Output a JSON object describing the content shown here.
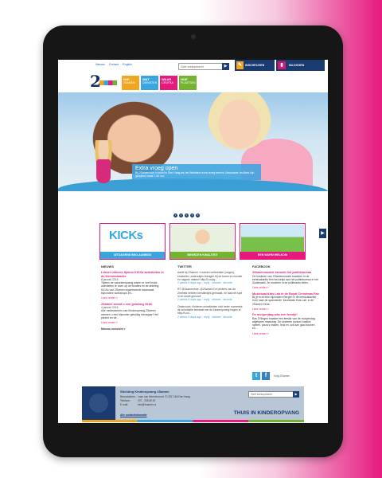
{
  "header": {
    "top_links": [
      "Nieuws",
      "Contact",
      "English"
    ],
    "search_placeholder": "Geef zoekopdracht",
    "inschrijven": "INSCHRIJVEN",
    "inloggen": "INLOGGEN",
    "logo_text": "2",
    "categories": [
      {
        "title": "WIE",
        "sub": "2SAMEN",
        "color": "#f2a61f"
      },
      {
        "title": "WAT",
        "sub": "DIENSTEN",
        "color": "#3aa6e0"
      },
      {
        "title": "WAAR",
        "sub": "CENTRA",
        "color": "#e6197f"
      },
      {
        "title": "HOE",
        "sub": "PLAATSEN",
        "color": "#73b431"
      }
    ]
  },
  "hero": {
    "title": "Extra vroeg open",
    "text": "Bij 2Samen kun u voorzi in Den Haag als het Westland extra vroeg terecht. Maandane: teo5bes zijn geopend vanaf 7.00 uur.",
    "dots": [
      "1",
      "2",
      "3",
      "4",
      "5"
    ]
  },
  "cards": [
    {
      "label": "UITDAGEND BSO-AANBOD",
      "color": "#3aa6e0",
      "kicks": "KICKs"
    },
    {
      "label": "BEWEZEN KWALITEIT",
      "color": "#73b431"
    },
    {
      "label": "EEN WARM WELKOM",
      "color": "#e6197f"
    }
  ],
  "nieuws": {
    "heading": "NIEUWS",
    "items": [
      {
        "title": "Lekker uitleven tijdens KICKs activiteiten in de Kennisviaartie",
        "date": "8 januari 2016",
        "body": "Tijdens de vakantieopvang waren er veel leuke activiteiten te doen op de locaties en de afdeling KICKs van 2Samen organiseerde daarnaast bijzondere workshops en...",
        "more": "Lees verder »"
      },
      {
        "title": "2Samen wenst u een gelukkig 2016!",
        "date": "4 januari 2016",
        "body": "Alle medewerkers van Kinderopvang 2Samen wensen u een bijzonder gelukkig nieuwjaar! Het plezier en de...",
        "more": "Lees verder »"
      }
    ],
    "overzicht": "Nieuws overzicht »"
  },
  "twitter": {
    "heading": "TWITTER",
    "items": [
      {
        "text": "Aardt bij 2Samen 'n samen verbeelden (ongen), knutselen, zadeuutjes brengen bij de buren en muziek en happes maken! http://t.co/yq...",
        "meta": "2 weeks 5 days ago · reply · retweet · favorite"
      },
      {
        "text": "RT @2samenhoe: @2Samen De peuters van de Zeeheld hebben kerstliedjes gemaakt, en laat het spel in en smelt gezond!",
        "meta": "2 weeks 5 days ago · reply · retweet · favorite"
      },
      {
        "text": "Onderzoek: kinderen ontwikkelen zich beter roummels de scholastie ieerdaat van de kinderopvang hogen is: http://t.co/...",
        "meta": "2 weeks 5 days ago · reply · retweet · favorite"
      }
    ]
  },
  "facebook": {
    "heading": "FACEBOOK",
    "items": [
      {
        "title": "2Samenmuziek bezoekt het politiebureau",
        "body": "De kinderen van 2Samenmuziek brachten in de kerstvakantie een bezoekje aan het politiebureau in het Zuiderpark! Ze mochten in de politieauto zitten...",
        "more": "Lees verder »"
      },
      {
        "title": "Muziekaal Kids Lab in de Royal Christmas Fair",
        "body": "Bij je echt leke bijzondere Bergen in de kerstvakantie! Kom naar de spannende 'Muziekale Kids Lab' in de 2Samen Kerst...",
        "more": "Lees verder »"
      },
      {
        "title": "De morgendag was een feestje!",
        "body": "Bas 2Vlingen maakte een feestje van de morgendag afgelopen maandag. De kinderen kunnen kastiiel spelen, pizza's maken, leuk en ook aan gaa bouwen en...",
        "more": "Lees verder »"
      }
    ],
    "social_like": "Volg 2Samen"
  },
  "footer": {
    "name": "Stichting Kinderopvang 2Samen",
    "rows": [
      {
        "k": "Bezoekadres:",
        "v": "Laan van Meerdervoort 70 2517 AN Den Haag"
      },
      {
        "k": "Telefoon:",
        "v": "070 - 338 65 00"
      },
      {
        "k": "E-mail:",
        "v": "info@2samen.nl"
      }
    ],
    "link": "Alle contactinformatie",
    "search_placeholder": "Geef zoekopdracht",
    "slogan": "THUIS IN KINDEROPVANG"
  }
}
